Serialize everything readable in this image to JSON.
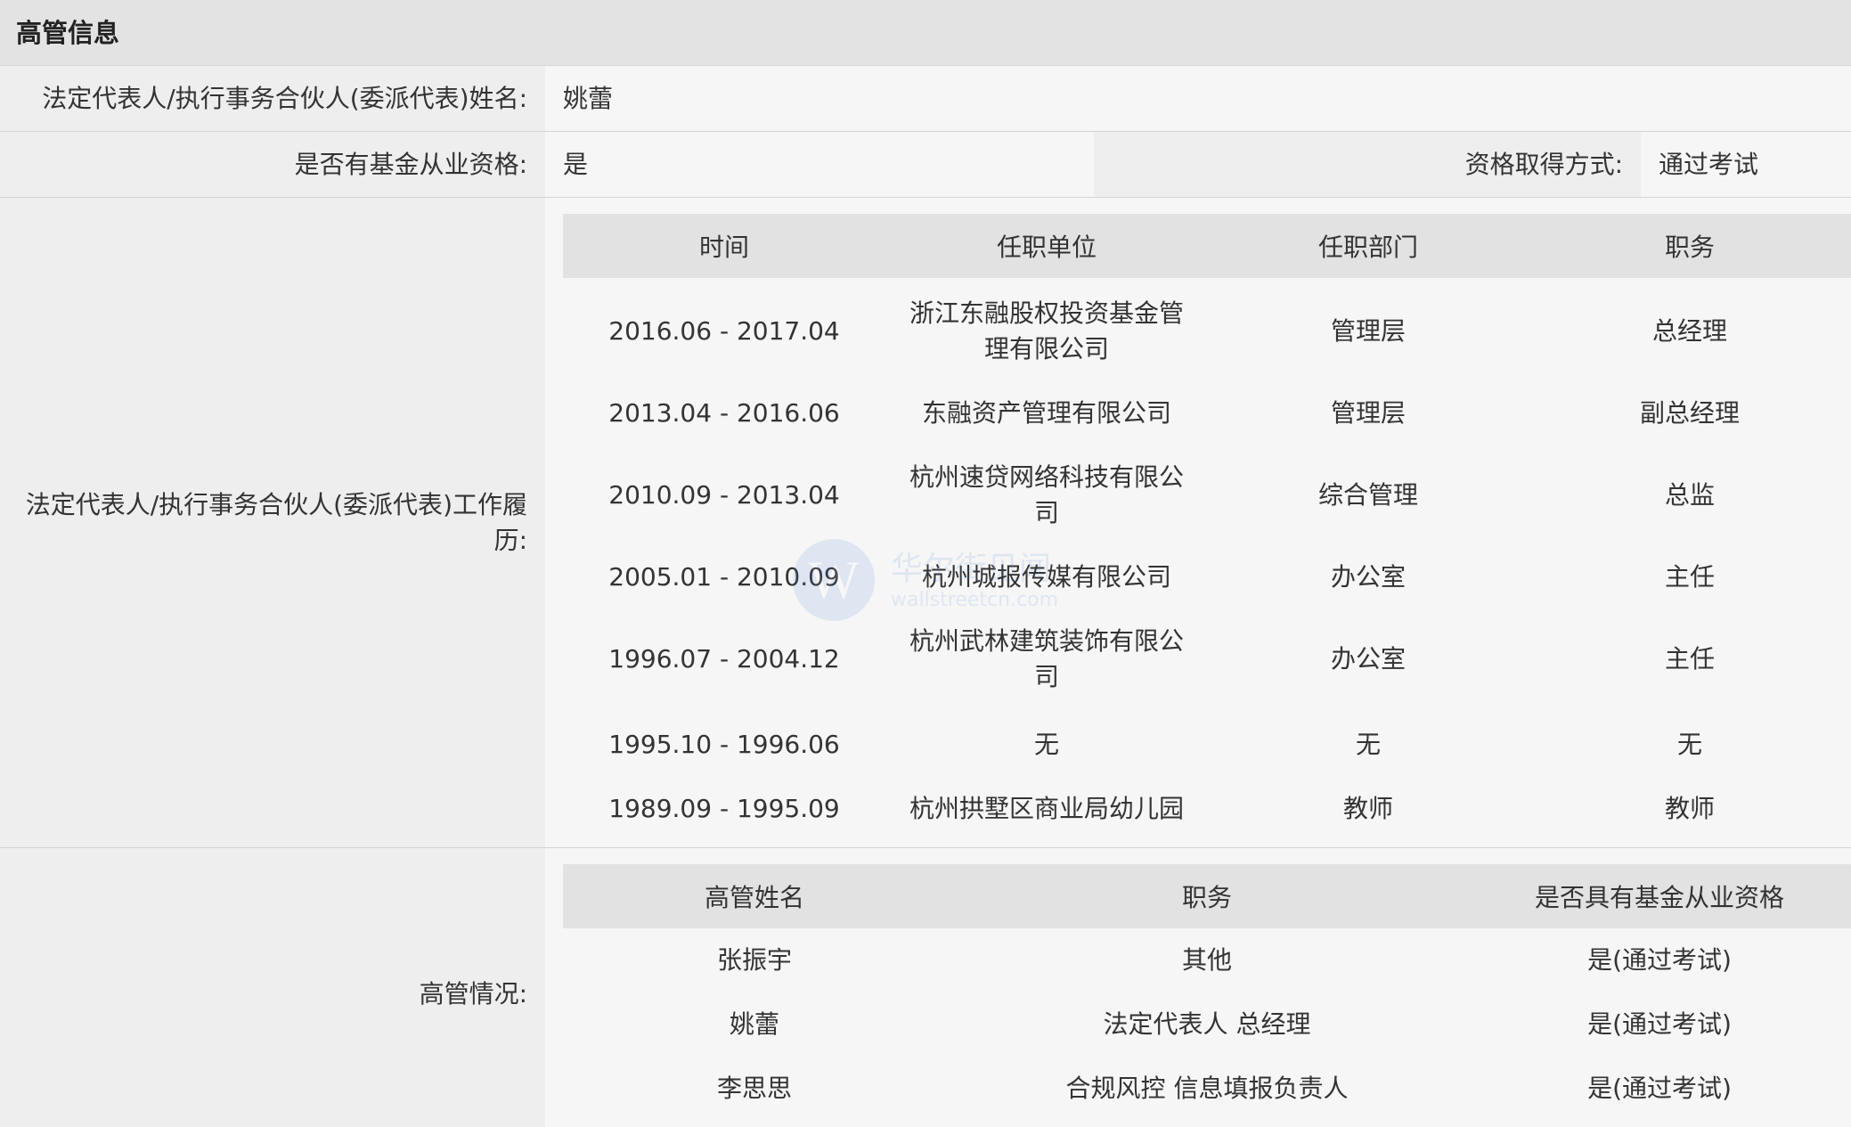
{
  "section": {
    "title": "高管信息"
  },
  "legal_rep": {
    "label": "法定代表人/执行事务合伙人(委派代表)姓名:",
    "value": "姚蕾"
  },
  "qualification": {
    "label": "是否有基金从业资格:",
    "value": "是",
    "method_label": "资格取得方式:",
    "method_value": "通过考试"
  },
  "work_history": {
    "label": "法定代表人/执行事务合伙人(委派代表)工作履历:",
    "columns": [
      "时间",
      "任职单位",
      "任职部门",
      "职务"
    ],
    "rows": [
      {
        "time": "2016.06 - 2017.04",
        "company": "浙江东融股权投资基金管理有限公司",
        "dept": "管理层",
        "title": "总经理"
      },
      {
        "time": "2013.04 - 2016.06",
        "company": "东融资产管理有限公司",
        "dept": "管理层",
        "title": "副总经理"
      },
      {
        "time": "2010.09 - 2013.04",
        "company": "杭州速贷网络科技有限公司",
        "dept": "综合管理",
        "title": "总监"
      },
      {
        "time": "2005.01 - 2010.09",
        "company": "杭州城报传媒有限公司",
        "dept": "办公室",
        "title": "主任"
      },
      {
        "time": "1996.07 - 2004.12",
        "company": "杭州武林建筑装饰有限公司",
        "dept": "办公室",
        "title": "主任"
      },
      {
        "time": "1995.10 - 1996.06",
        "company": "无",
        "dept": "无",
        "title": "无"
      },
      {
        "time": "1989.09 - 1995.09",
        "company": "杭州拱墅区商业局幼儿园",
        "dept": "教师",
        "title": "教师"
      }
    ]
  },
  "executives": {
    "label": "高管情况:",
    "columns": [
      "高管姓名",
      "职务",
      "是否具有基金从业资格"
    ],
    "rows": [
      {
        "name": "张振宇",
        "title": "其他",
        "qualified": "是(通过考试)"
      },
      {
        "name": "姚蕾",
        "title": "法定代表人 总经理",
        "qualified": "是(通过考试)"
      },
      {
        "name": "李思思",
        "title": "合规风控 信息填报负责人",
        "qualified": "是(通过考试)"
      }
    ]
  },
  "watermark": {
    "logo_letter": "W",
    "text": "华尔街见闻",
    "sub": "wallstreetcn.com"
  }
}
